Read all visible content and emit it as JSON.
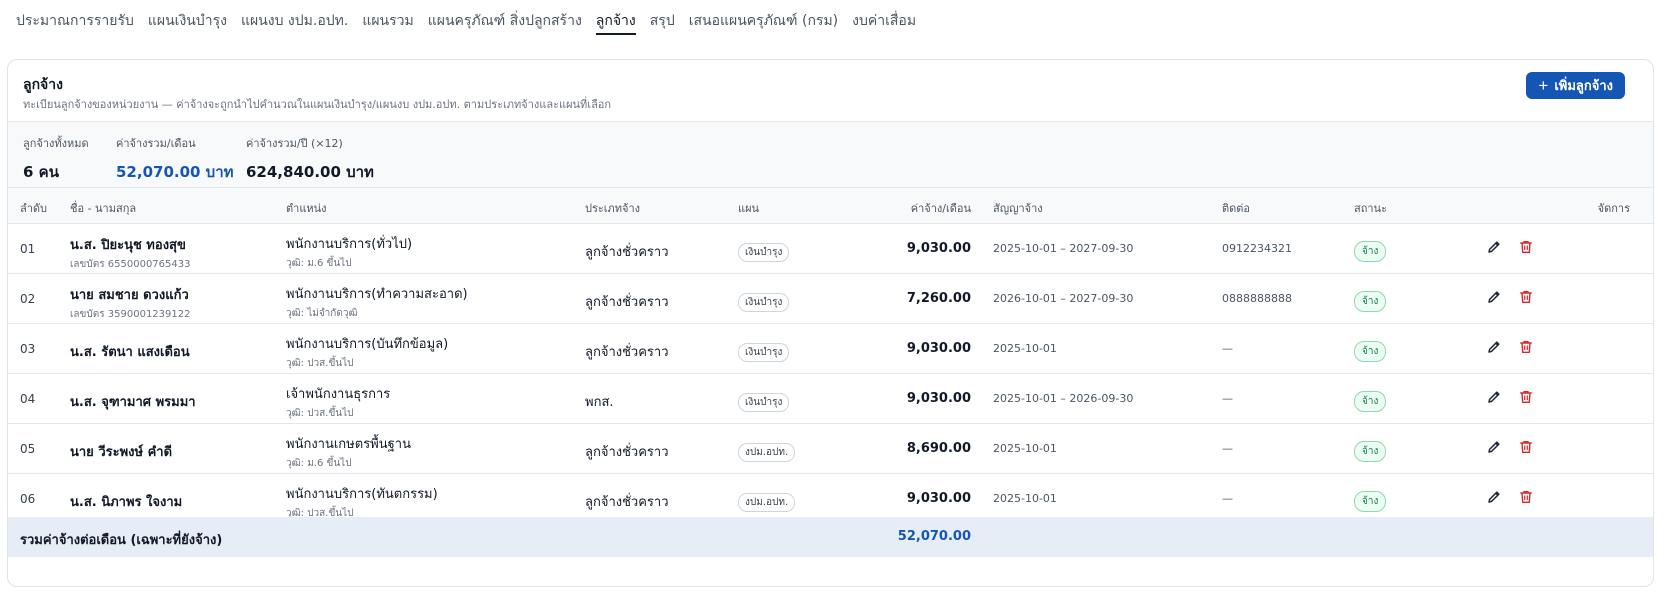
{
  "tabs": [
    {
      "label": "ประมาณการรายรับ",
      "active": false
    },
    {
      "label": "แผนเงินบำรุง",
      "active": false
    },
    {
      "label": "แผนงบ งปม.อปท.",
      "active": false
    },
    {
      "label": "แผนรวม",
      "active": false
    },
    {
      "label": "แผนครุภัณฑ์ สิ่งปลูกสร้าง",
      "active": false
    },
    {
      "label": "ลูกจ้าง",
      "active": true
    },
    {
      "label": "สรุป",
      "active": false
    },
    {
      "label": "เสนอแผนครุภัณฑ์ (กรม)",
      "active": false
    },
    {
      "label": "งบค่าเสื่อม",
      "active": false
    }
  ],
  "card": {
    "title": "ลูกจ้าง",
    "subtitle": "ทะเบียนลูกจ้างของหน่วยงาน — ค่าจ้างจะถูกนำไปคำนวณในแผนเงินบำรุง/แผนงบ งปม.อปท. ตามประเภทจ้างและแผนที่เลือก",
    "add_button": "เพิ่มลูกจ้าง",
    "add_icon": "plus-icon"
  },
  "summary": {
    "total_label": "ลูกจ้างทั้งหมด",
    "total_value": "6 คน",
    "monthly_label": "ค่าจ้างรวม/เดือน",
    "monthly_value": "52,070.00 บาท",
    "yearly_label": "ค่าจ้างรวม/ปี (×12)",
    "yearly_value": "624,840.00 บาท"
  },
  "table": {
    "headers": {
      "idx": "ลำดับ",
      "name": "ชื่อ - นามสกุล",
      "position": "ตำแหน่ง",
      "type": "ประเภทจ้าง",
      "plan": "แผน",
      "wage": "ค่าจ้าง/เดือน",
      "contract": "สัญญาจ้าง",
      "contact": "ติดต่อ",
      "status": "สถานะ",
      "actions": "จัดการ"
    },
    "rows": [
      {
        "idx": "01",
        "name": "น.ส. ปิยะนุช ทองสุข",
        "id": "เลขบัตร 6550000765433",
        "position": "พนักงานบริการ(ทั่วไป)",
        "qual": "วุฒิ: ม.6 ขึ้นไป",
        "type": "ลูกจ้างชั่วคราว",
        "plan": "เงินบำรุง",
        "wage": "9,030.00",
        "contract": "2025-10-01 – 2027-09-30",
        "contact": "0912234321",
        "status": "จ้าง"
      },
      {
        "idx": "02",
        "name": "นาย สมชาย ดวงแก้ว",
        "id": "เลขบัตร 3590001239122",
        "position": "พนักงานบริการ(ทำความสะอาด)",
        "qual": "วุฒิ: ไม่จำกัดวุฒิ",
        "type": "ลูกจ้างชั่วคราว",
        "plan": "เงินบำรุง",
        "wage": "7,260.00",
        "contract": "2026-10-01 – 2027-09-30",
        "contact": "0888888888",
        "status": "จ้าง"
      },
      {
        "idx": "03",
        "name": "น.ส. รัตนา แสงเดือน",
        "id": "",
        "position": "พนักงานบริการ(บันทึกข้อมูล)",
        "qual": "วุฒิ: ปวส.ขึ้นไป",
        "type": "ลูกจ้างชั่วคราว",
        "plan": "เงินบำรุง",
        "wage": "9,030.00",
        "contract": "2025-10-01",
        "contact": "—",
        "status": "จ้าง"
      },
      {
        "idx": "04",
        "name": "น.ส. จุฑามาศ พรมมา",
        "id": "",
        "position": "เจ้าพนักงานธุรการ",
        "qual": "วุฒิ: ปวส.ขึ้นไป",
        "type": "พกส.",
        "plan": "เงินบำรุง",
        "wage": "9,030.00",
        "contract": "2025-10-01 – 2026-09-30",
        "contact": "—",
        "status": "จ้าง"
      },
      {
        "idx": "05",
        "name": "นาย วีระพงษ์ คำดี",
        "id": "",
        "position": "พนักงานเกษตรพื้นฐาน",
        "qual": "วุฒิ: ม.6 ขึ้นไป",
        "type": "ลูกจ้างชั่วคราว",
        "plan": "งปม.อปท.",
        "wage": "8,690.00",
        "contract": "2025-10-01",
        "contact": "—",
        "status": "จ้าง"
      },
      {
        "idx": "06",
        "name": "น.ส. นิภาพร ใจงาม",
        "id": "",
        "position": "พนักงานบริการ(ทันตกรรม)",
        "qual": "วุฒิ: ปวส.ขึ้นไป",
        "type": "ลูกจ้างชั่วคราว",
        "plan": "งปม.อปท.",
        "wage": "9,030.00",
        "contract": "2025-10-01",
        "contact": "—",
        "status": "จ้าง"
      }
    ],
    "footer_label": "รวมค่าจ้างต่อเดือน (เฉพาะที่ยังจ้าง)",
    "footer_total": "52,070.00"
  },
  "colors": {
    "accent": "#1556b4",
    "status_green": "#127d4d",
    "delete_red": "#dc2626"
  }
}
